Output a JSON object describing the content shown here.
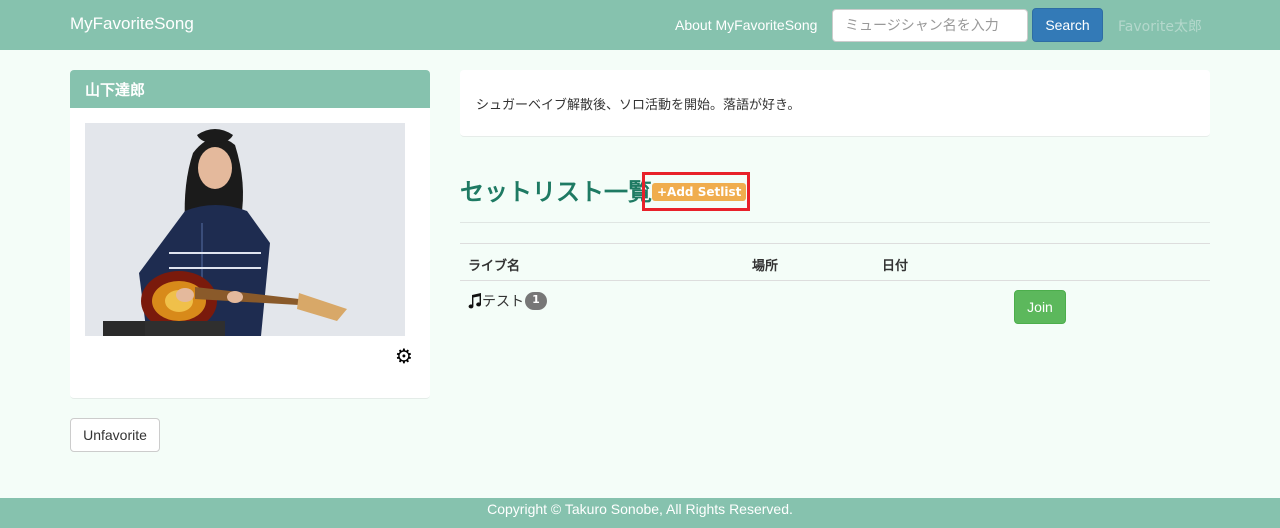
{
  "navbar": {
    "brand": "MyFavoriteSong",
    "about_link": "About MyFavoriteSong",
    "search_placeholder": "ミュージシャン名を入力",
    "search_button": "Search",
    "user_name": "Favorite太郎"
  },
  "artist_panel": {
    "name": "山下達郎",
    "photo_icon": "artist-photo",
    "settings_icon": "gear-icon"
  },
  "unfavorite_button": "Unfavorite",
  "description": "シュガーベイブ解散後、ソロ活動を開始。落語が好き。",
  "setlist_section": {
    "title": "セットリスト一覧",
    "add_label": "+Add Setlist"
  },
  "table": {
    "headers": [
      "ライブ名",
      "場所",
      "日付"
    ],
    "rows": [
      {
        "icon": "music-note-icon",
        "name": "テスト",
        "badge": "1",
        "place": "",
        "date": "",
        "join_label": "Join"
      }
    ]
  },
  "footer": {
    "copyright": "Copyright © Takuro Sonobe, All Rights Reserved."
  },
  "colors": {
    "navbar": "#86c2ae",
    "page_background": "#f4fdf8",
    "title": "#1e7a63",
    "search_button": "#337ab7",
    "add_label": "#f0ad4e",
    "join_button": "#5cb85c",
    "highlight": "#e8212a"
  }
}
